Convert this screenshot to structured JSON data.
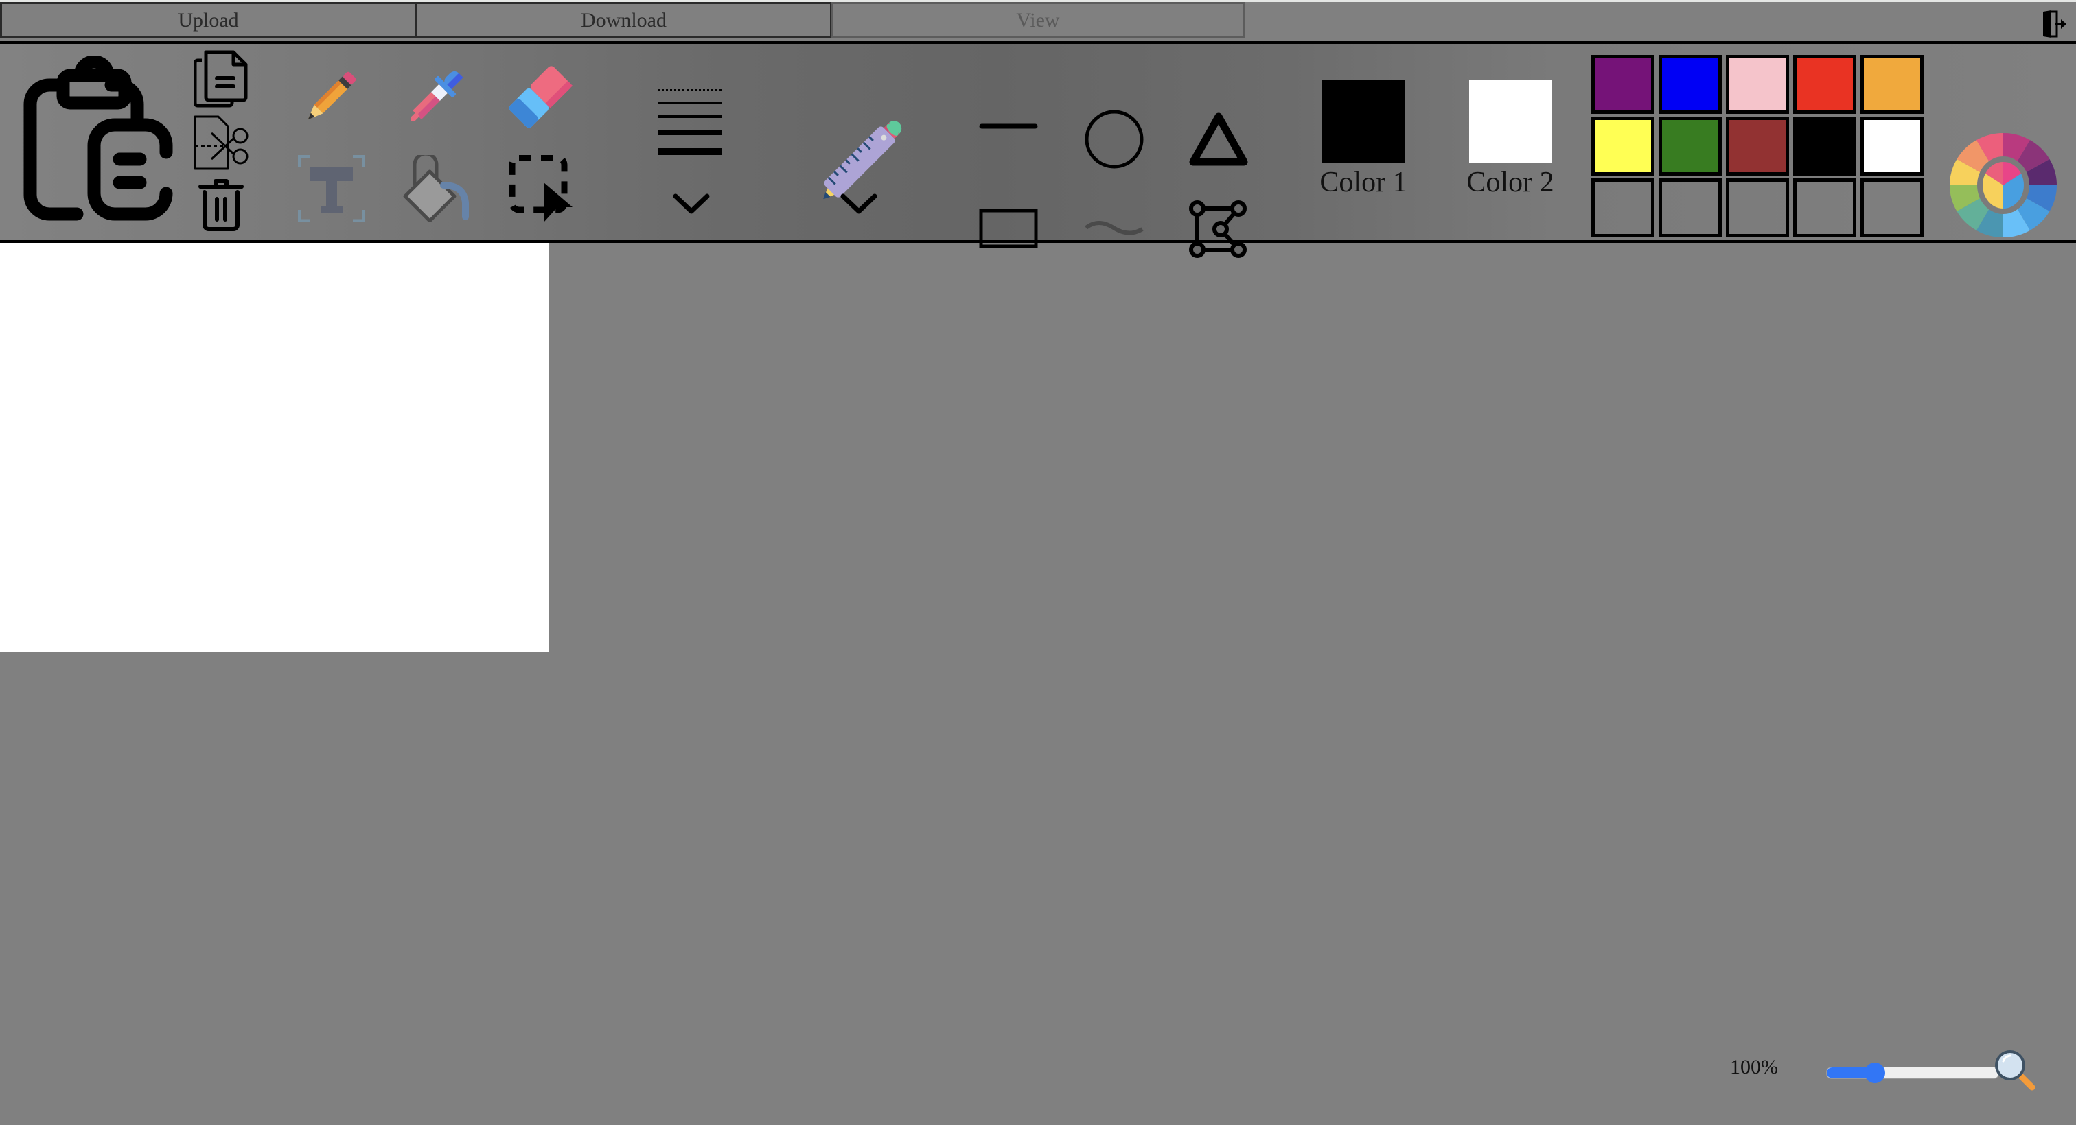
{
  "tabs": [
    {
      "label": "Upload",
      "enabled": true
    },
    {
      "label": "Download",
      "enabled": true
    },
    {
      "label": "View",
      "enabled": false
    }
  ],
  "header": {
    "exit_icon": "exit-door-icon"
  },
  "toolbar": {
    "clipboard": {
      "paste_icon": "clipboard-paste-icon",
      "copy_icon": "copy-icon",
      "cut_icon": "cut-scissors-icon",
      "delete_icon": "trash-icon"
    },
    "tools": [
      {
        "name": "pencil",
        "icon": "pencil-icon"
      },
      {
        "name": "color-picker",
        "icon": "eyedropper-icon"
      },
      {
        "name": "eraser",
        "icon": "eraser-icon"
      },
      {
        "name": "text",
        "icon": "text-icon"
      },
      {
        "name": "fill",
        "icon": "paint-bucket-icon"
      },
      {
        "name": "select",
        "icon": "selection-icon"
      }
    ],
    "line_width_icon": "line-width-icon",
    "brushes_icon": "ruler-pencil-icon",
    "shapes": [
      {
        "name": "line",
        "icon": "line-icon"
      },
      {
        "name": "circle",
        "icon": "circle-icon"
      },
      {
        "name": "triangle",
        "icon": "triangle-icon"
      },
      {
        "name": "rectangle",
        "icon": "rectangle-icon"
      },
      {
        "name": "curve",
        "icon": "curve-icon",
        "enabled": false
      },
      {
        "name": "polygon",
        "icon": "polygon-icon"
      }
    ],
    "color1": {
      "label": "Color 1",
      "value": "#000000"
    },
    "color2": {
      "label": "Color 2",
      "value": "#ffffff"
    },
    "palette": [
      "#751378",
      "#0000f5",
      "#f5c4cb",
      "#e93323",
      "#f0a93d",
      "#ffff54",
      "#387c21",
      "#923232",
      "#000000",
      "#ffffff",
      null,
      null,
      null,
      null,
      null
    ],
    "edit_colors_icon": "color-wheel-icon"
  },
  "zoom": {
    "label": "100%",
    "value_fraction": 0.28,
    "icon": "magnifier-icon"
  }
}
